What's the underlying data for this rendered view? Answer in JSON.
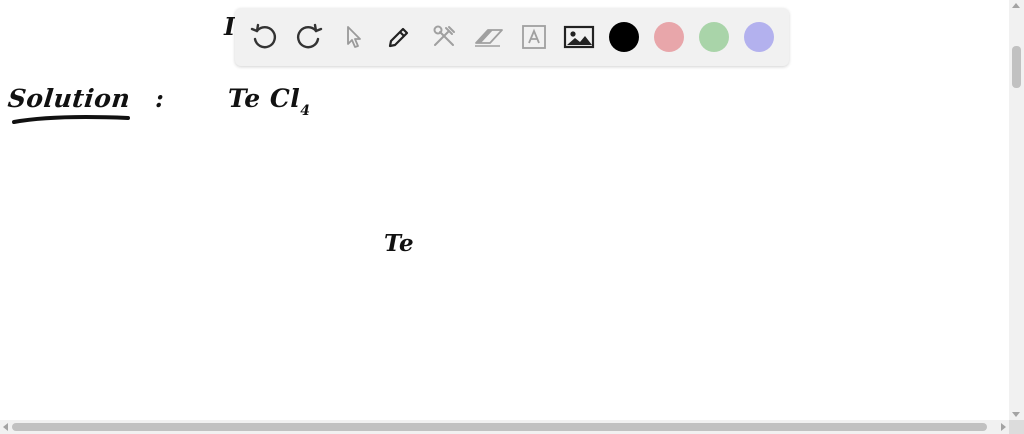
{
  "whiteboard": {
    "solution_label": "Solution",
    "colon": ":",
    "formula_main": "Te Cl",
    "formula_sub": "4",
    "center_atom": "Te",
    "partial_stroke": "I"
  },
  "toolbar": {
    "tools": [
      {
        "name": "undo",
        "icon": "undo-icon"
      },
      {
        "name": "redo",
        "icon": "redo-icon"
      },
      {
        "name": "select",
        "icon": "pointer-icon"
      },
      {
        "name": "pen",
        "icon": "pencil-icon"
      },
      {
        "name": "tools",
        "icon": "wrench-hammer-icon"
      },
      {
        "name": "eraser",
        "icon": "eraser-icon"
      },
      {
        "name": "text",
        "icon": "text-box-icon"
      },
      {
        "name": "image",
        "icon": "image-icon"
      }
    ],
    "colors": {
      "black": "#000000",
      "red": "#e8a6aa",
      "green": "#a9d4a9",
      "blue": "#b3b1ee"
    }
  }
}
